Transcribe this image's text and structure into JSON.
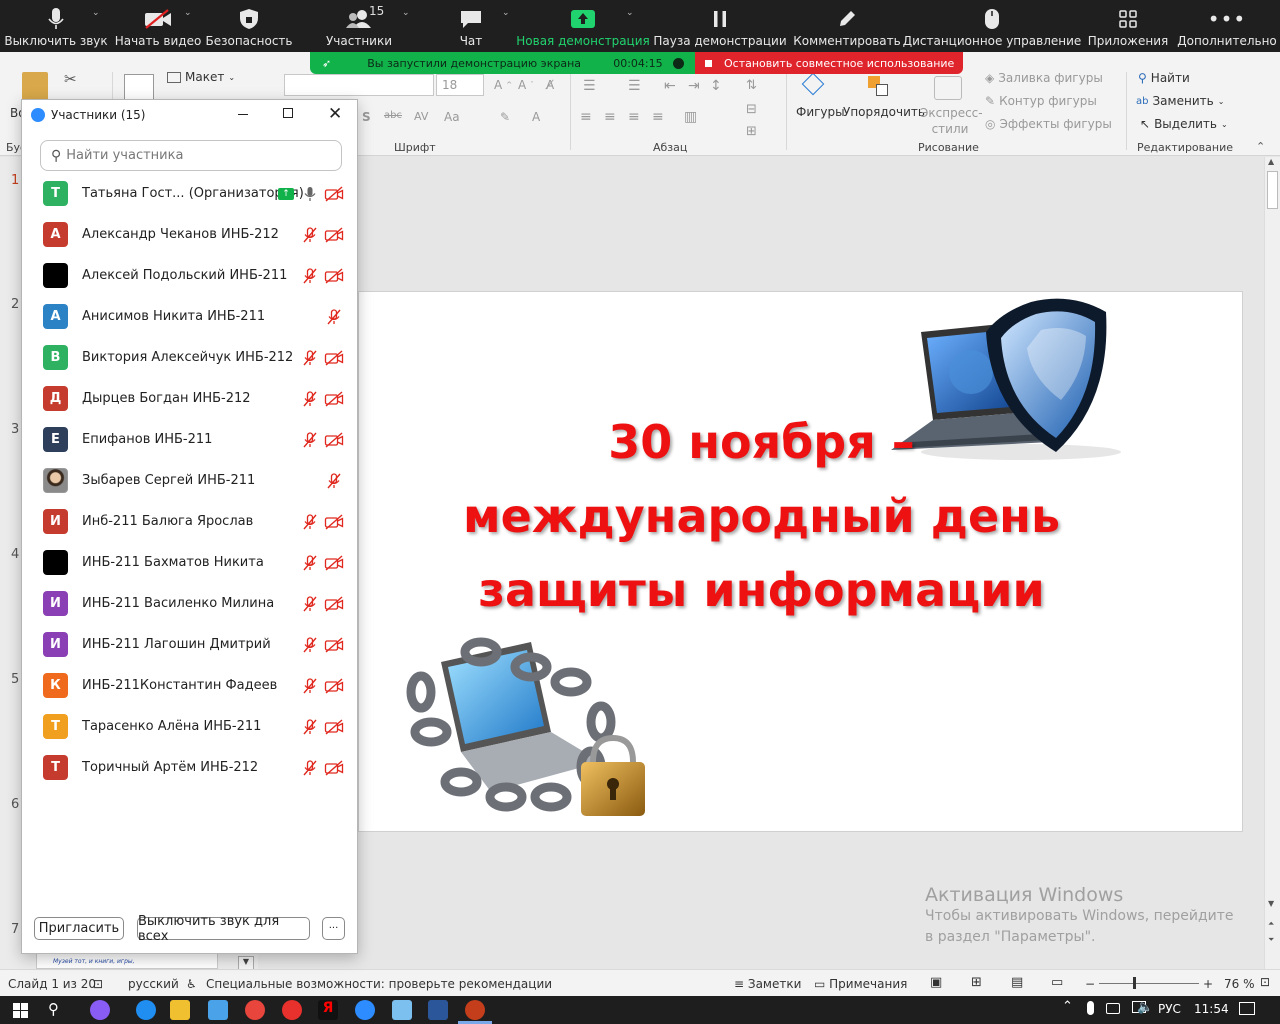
{
  "zoom_toolbar": {
    "mute": "Выключить звук",
    "start_video": "Начать видео",
    "security": "Безопасность",
    "participants": "Участники",
    "participants_count": "15",
    "chat": "Чат",
    "new_share": "Новая демонстрация",
    "pause_share": "Пауза демонстрации",
    "annotate": "Комментировать",
    "remote_control": "Дистанционное управление",
    "apps": "Приложения",
    "more": "Дополнительно"
  },
  "share_banner": {
    "message": "Вы запустили демонстрацию экрана",
    "timer": "00:04:15",
    "stop": "Остановить совместное использование"
  },
  "ribbon": {
    "layout": "Макет",
    "font_size": "18",
    "group_font": "Шрифт",
    "group_paragraph": "Абзац",
    "shapes": "Фигуры",
    "arrange": "Упорядочить",
    "quick_styles": "Экспресс-стили",
    "shape_fill": "Заливка фигуры",
    "shape_outline": "Контур фигуры",
    "shape_effects": "Эффекты фигуры",
    "group_drawing": "Рисование",
    "find": "Найти",
    "replace": "Заменить",
    "select": "Выделить",
    "group_editing": "Редактирование",
    "cut_label_partial": "Во",
    "group_clipboard_partial": "Буф"
  },
  "participants_window": {
    "title": "Участники (15)",
    "search_placeholder": "Найти участника",
    "invite": "Пригласить",
    "mute_all": "Выключить звук для всех",
    "more": "···",
    "participants": [
      {
        "initial": "Т",
        "name": "Татьяна Гост...  (Организатор, я)",
        "color": "#2eb262",
        "host": true
      },
      {
        "initial": "А",
        "name": "Александр Чеканов ИНБ-212",
        "color": "#c53b2e"
      },
      {
        "initial": "",
        "name": "Алексей Подольский ИНБ-211",
        "color": "#000000"
      },
      {
        "initial": "А",
        "name": "Анисимов Никита ИНБ-211",
        "color": "#2b82c4",
        "no_cam_icon": true
      },
      {
        "initial": "В",
        "name": "Виктория Алексейчук ИНБ-212",
        "color": "#2eb262"
      },
      {
        "initial": "Д",
        "name": "Дырцев Богдан ИНБ-212",
        "color": "#c53b2e"
      },
      {
        "initial": "Е",
        "name": "Епифанов ИНБ-211",
        "color": "#2e3f5c"
      },
      {
        "initial": "",
        "name": "Зыбарев Сергей ИНБ-211",
        "color": "#7a6a5a",
        "photo": true,
        "no_cam_icon": true
      },
      {
        "initial": "И",
        "name": "Инб-211 Балюга Ярослав",
        "color": "#c53b2e"
      },
      {
        "initial": "",
        "name": "ИНБ-211 Бахматов Никита",
        "color": "#000000"
      },
      {
        "initial": "И",
        "name": "ИНБ-211 Василенко Милина",
        "color": "#8b3fb5"
      },
      {
        "initial": "И",
        "name": "ИНБ-211 Лагошин Дмитрий",
        "color": "#8b3fb5"
      },
      {
        "initial": "К",
        "name": "ИНБ-211Константин Фадеев",
        "color": "#f06a1e"
      },
      {
        "initial": "Т",
        "name": "Тарасенко Алёна ИНБ-211",
        "color": "#f0a01e"
      },
      {
        "initial": "Т",
        "name": "Торичный Артём ИНБ-212",
        "color": "#c53b2e"
      }
    ]
  },
  "thumb_numbers": [
    "1",
    "2",
    "3",
    "4",
    "5",
    "6",
    "7"
  ],
  "thumb_caption": "Музей тот, и книги, игры,",
  "slide": {
    "title_lines": [
      "30 ноября –",
      "международный день",
      "защиты информации"
    ],
    "title_color": "#ee1111"
  },
  "watermark": {
    "title": "Активация Windows",
    "subtitle": "Чтобы активировать Windows, перейдите в раздел \"Параметры\"."
  },
  "statusbar": {
    "slide_info": "Слайд 1 из 20",
    "language": "русский",
    "accessibility": "Специальные возможности: проверьте рекомендации",
    "notes": "Заметки",
    "comments": "Примечания",
    "zoom": "76 %"
  },
  "taskbar": {
    "lang": "РУС",
    "time": "11:54"
  }
}
